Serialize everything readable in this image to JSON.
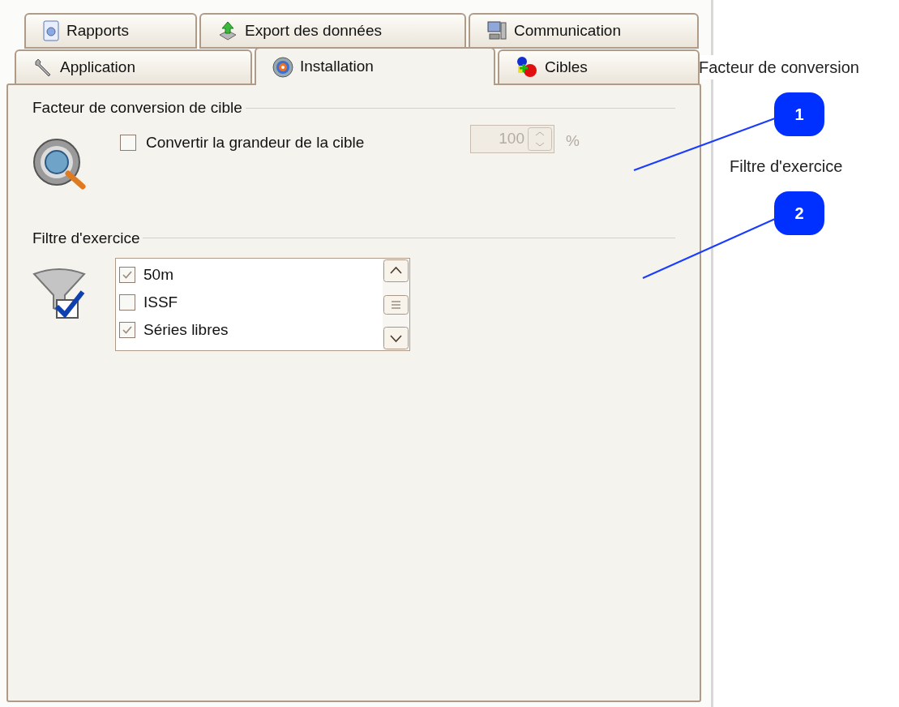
{
  "tab_rows": [
    [
      {
        "label": "Rapports",
        "selected": false
      },
      {
        "label": "Export des données",
        "selected": false
      },
      {
        "label": "Communication",
        "selected": false
      }
    ],
    [
      {
        "label": "Application",
        "selected": false
      },
      {
        "label": "Installation",
        "selected": true
      },
      {
        "label": "Cibles",
        "selected": false
      }
    ]
  ],
  "conversion": {
    "title": "Facteur de conversion de cible",
    "checkbox": {
      "label": "Convertir la grandeur de la cible",
      "checked": false
    },
    "spin": {
      "value": "100",
      "unit": "%",
      "disabled": true
    }
  },
  "filter": {
    "title": "Filtre d'exercice",
    "items": [
      {
        "label": "50m",
        "checked": true
      },
      {
        "label": "ISSF",
        "checked": false
      },
      {
        "label": "Séries libres",
        "checked": true
      }
    ]
  },
  "callouts": [
    {
      "label": "Facteur de conversion",
      "number": "1"
    },
    {
      "label": "Filtre d'exercice",
      "number": "2"
    }
  ]
}
